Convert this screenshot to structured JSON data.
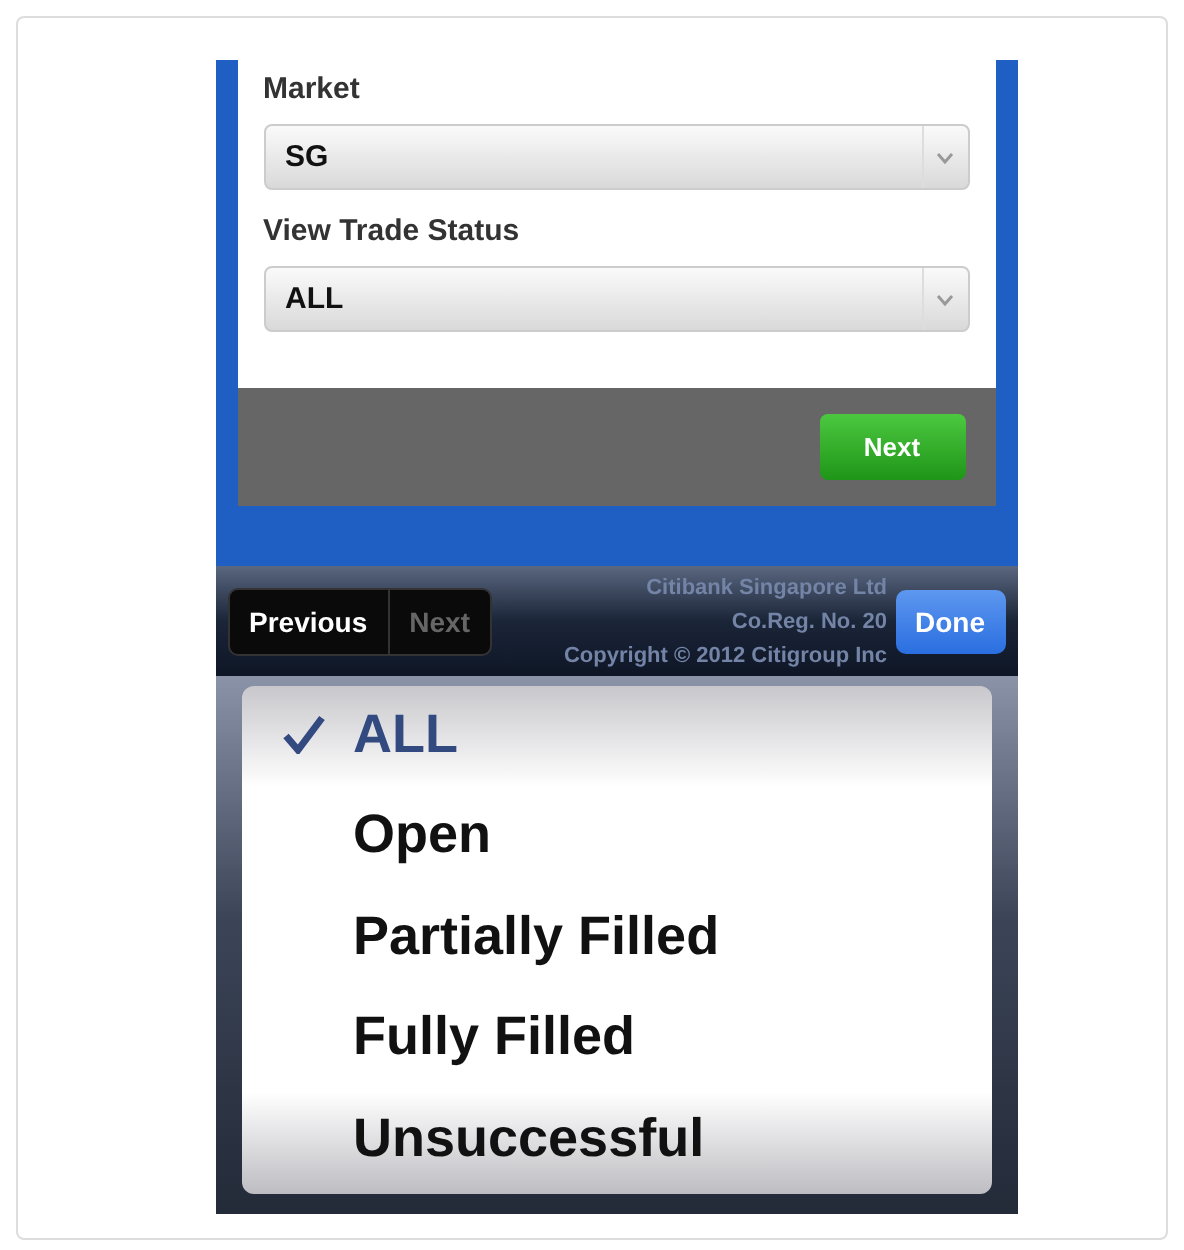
{
  "form": {
    "fields": [
      {
        "label": "Market",
        "value": "SG"
      },
      {
        "label": "View Trade Status",
        "value": "ALL"
      }
    ],
    "next_button": "Next"
  },
  "footer": [
    "Citibank Singapore Ltd",
    "Co.Reg. No. 20",
    "Copyright © 2012 Citigroup Inc"
  ],
  "toolbar": {
    "nav_buttons": [
      {
        "label": "Previous",
        "disabled": false
      },
      {
        "label": "Next",
        "disabled": true
      }
    ],
    "done_button": "Done"
  },
  "picker": {
    "options": [
      {
        "label": "ALL",
        "selected": true
      },
      {
        "label": "Open",
        "selected": false
      },
      {
        "label": "Partially Filled",
        "selected": false
      },
      {
        "label": "Fully Filled",
        "selected": false
      },
      {
        "label": "Unsuccessful",
        "selected": false
      }
    ]
  }
}
